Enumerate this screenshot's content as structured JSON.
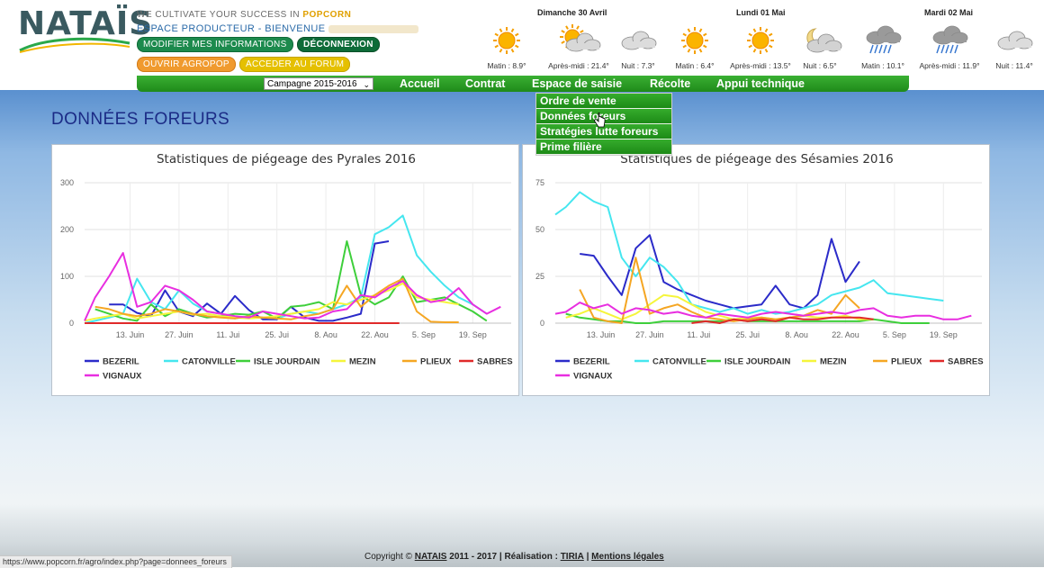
{
  "brand": {
    "logo_text": "NATAÏS",
    "tagline_prefix": "WE CULTIVATE YOUR SUCCESS IN",
    "tagline_accent": "POPCORN",
    "espace": "ESPACE PRODUCTEUR - BIENVENUE"
  },
  "header_buttons": {
    "modifier": "MODIFIER MES INFORMATIONS",
    "deconnexion": "DÉCONNEXION",
    "agropop": "OUVRIR AGROPOP",
    "forum": "ACCEDER AU FORUM"
  },
  "weather": {
    "days": [
      "Dimanche 30 Avril",
      "Lundi 01 Mai",
      "Mardi 02 Mai"
    ],
    "slots": [
      {
        "label": "Matin : 8.9°",
        "icon": "sun-icon"
      },
      {
        "label": "Après-midi : 21.4°",
        "icon": "sun-cloud-icon"
      },
      {
        "label": "Nuit : 7.3°",
        "icon": "cloud-icon"
      },
      {
        "label": "Matin : 6.4°",
        "icon": "sun-icon"
      },
      {
        "label": "Après-midi : 13.5°",
        "icon": "sun-icon"
      },
      {
        "label": "Nuit : 6.5°",
        "icon": "moon-cloud-icon"
      },
      {
        "label": "Matin : 10.1°",
        "icon": "rain-icon"
      },
      {
        "label": "Après-midi : 11.9°",
        "icon": "rain-icon"
      },
      {
        "label": "Nuit : 11.4°",
        "icon": "cloud-icon"
      }
    ]
  },
  "nav": {
    "campaign_select": "Campagne 2015-2016",
    "items": [
      "Accueil",
      "Contrat",
      "Espace de saisie",
      "Récolte",
      "Appui technique"
    ],
    "dropdown": [
      "Ordre de vente",
      "Données foreurs",
      "Stratégies lutte foreurs",
      "Prime filière"
    ]
  },
  "page_title": "DONNÉES FOREURS",
  "chart_data": [
    {
      "type": "line",
      "title": "Statistiques de piégeage des Pyrales 2016",
      "x_tick_labels": [
        "13. Juin",
        "27. Juin",
        "11. Jui",
        "25. Jui",
        "8. Aou",
        "22. Aou",
        "5. Sep",
        "19. Sep"
      ],
      "x_ticks": [
        13,
        27,
        41,
        55,
        69,
        83,
        97,
        111
      ],
      "xlim": [
        0,
        122
      ],
      "y_ticks": [
        0,
        100,
        200,
        300
      ],
      "ylim": [
        0,
        300
      ],
      "grid": true,
      "legend_placement": "bottom",
      "series": [
        {
          "name": "BEZERIL",
          "color": "#2b2bc9",
          "x": [
            7,
            11,
            15,
            19,
            23,
            27,
            31,
            35,
            39,
            43,
            47,
            51,
            55,
            59,
            63,
            67,
            71,
            75,
            79,
            83,
            87
          ],
          "y": [
            40,
            40,
            22,
            15,
            70,
            25,
            15,
            42,
            20,
            58,
            28,
            8,
            8,
            35,
            12,
            5,
            5,
            12,
            20,
            170,
            175
          ]
        },
        {
          "name": "CATONVILLE",
          "color": "#45e6ef",
          "x": [
            0,
            3,
            7,
            11,
            15,
            19,
            23,
            27,
            31,
            35,
            39,
            43,
            47,
            51,
            55,
            59,
            63,
            67,
            71,
            75,
            79,
            83,
            87,
            91,
            95,
            99,
            103,
            107,
            111,
            115
          ],
          "y": [
            0,
            5,
            12,
            20,
            95,
            45,
            30,
            70,
            42,
            25,
            20,
            10,
            15,
            12,
            10,
            20,
            25,
            20,
            30,
            40,
            55,
            190,
            205,
            230,
            145,
            110,
            80,
            55,
            40,
            20
          ]
        },
        {
          "name": "ISLE JOURDAIN",
          "color": "#3ecf3b",
          "x": [
            3,
            7,
            11,
            15,
            19,
            23,
            27,
            31,
            35,
            39,
            43,
            47,
            51,
            55,
            59,
            63,
            67,
            71,
            75,
            79,
            83,
            87,
            91,
            95,
            99,
            103,
            107,
            111,
            115
          ],
          "y": [
            30,
            20,
            10,
            5,
            40,
            15,
            30,
            20,
            12,
            15,
            20,
            18,
            25,
            10,
            35,
            38,
            45,
            30,
            175,
            60,
            40,
            55,
            100,
            45,
            50,
            55,
            40,
            25,
            5
          ]
        },
        {
          "name": "MEZIN",
          "color": "#f5f53b",
          "x": [
            0,
            3,
            7,
            11,
            15,
            19,
            23,
            27,
            31,
            35,
            39,
            43,
            47,
            51,
            55,
            59,
            63,
            67,
            71,
            75,
            79,
            83,
            87,
            91,
            95,
            99,
            103,
            107
          ],
          "y": [
            5,
            10,
            15,
            20,
            10,
            15,
            20,
            25,
            18,
            20,
            15,
            12,
            10,
            12,
            15,
            20,
            25,
            30,
            45,
            40,
            50,
            60,
            70,
            85,
            55,
            50,
            45,
            40
          ]
        },
        {
          "name": "PLIEUX",
          "color": "#f5a623",
          "x": [
            3,
            7,
            11,
            15,
            19,
            23,
            27,
            31,
            35,
            39,
            43,
            47,
            51,
            55,
            59,
            63,
            67,
            71,
            75,
            79,
            83,
            87,
            91,
            95,
            99,
            103,
            107
          ],
          "y": [
            35,
            30,
            20,
            15,
            20,
            30,
            25,
            20,
            15,
            12,
            10,
            15,
            12,
            10,
            8,
            15,
            20,
            30,
            80,
            35,
            60,
            80,
            95,
            25,
            3,
            2,
            2
          ]
        },
        {
          "name": "SABRES",
          "color": "#e02a2a",
          "x": [
            0,
            10,
            20,
            30,
            40,
            50,
            60,
            70,
            80,
            90
          ],
          "y": [
            0,
            0,
            0,
            0,
            0,
            0,
            0,
            0,
            0,
            0
          ]
        },
        {
          "name": "VIGNAUX",
          "color": "#e82ee0",
          "x": [
            0,
            3,
            7,
            11,
            15,
            19,
            23,
            27,
            31,
            35,
            39,
            43,
            47,
            51,
            55,
            59,
            63,
            67,
            71,
            75,
            79,
            83,
            87,
            91,
            95,
            99,
            103,
            107,
            111,
            115,
            119
          ],
          "y": [
            5,
            55,
            100,
            150,
            35,
            45,
            80,
            70,
            50,
            25,
            20,
            15,
            12,
            25,
            20,
            15,
            10,
            12,
            25,
            30,
            60,
            55,
            75,
            90,
            60,
            45,
            50,
            75,
            40,
            20,
            35
          ]
        }
      ]
    },
    {
      "type": "line",
      "title": "Statistiques de piégeage des Sésamies 2016",
      "x_tick_labels": [
        "13. Juin",
        "27. Juin",
        "11. Jui",
        "25. Jui",
        "8. Aou",
        "22. Aou",
        "5. Sep",
        "19. Sep"
      ],
      "x_ticks": [
        13,
        27,
        41,
        55,
        69,
        83,
        97,
        111
      ],
      "xlim": [
        0,
        122
      ],
      "y_ticks": [
        0,
        25,
        50,
        75
      ],
      "ylim": [
        0,
        75
      ],
      "grid": true,
      "legend_placement": "bottom",
      "series": [
        {
          "name": "BEZERIL",
          "color": "#2b2bc9",
          "x": [
            7,
            11,
            15,
            19,
            23,
            27,
            31,
            35,
            39,
            43,
            47,
            51,
            55,
            59,
            63,
            67,
            71,
            75,
            79,
            83,
            87
          ],
          "y": [
            37,
            36,
            25,
            15,
            40,
            47,
            22,
            18,
            15,
            12,
            10,
            8,
            9,
            10,
            20,
            10,
            8,
            15,
            45,
            22,
            33
          ]
        },
        {
          "name": "CATONVILLE",
          "color": "#45e6ef",
          "x": [
            0,
            3,
            7,
            11,
            15,
            19,
            23,
            27,
            31,
            35,
            39,
            43,
            47,
            51,
            55,
            59,
            63,
            67,
            71,
            75,
            79,
            83,
            87,
            91,
            95,
            99,
            103,
            107,
            111
          ],
          "y": [
            58,
            62,
            70,
            65,
            62,
            35,
            25,
            35,
            30,
            22,
            10,
            8,
            6,
            8,
            5,
            7,
            5,
            6,
            8,
            10,
            15,
            17,
            19,
            23,
            16,
            15,
            14,
            13,
            12
          ]
        },
        {
          "name": "ISLE JOURDAIN",
          "color": "#3ecf3b",
          "x": [
            3,
            7,
            11,
            15,
            19,
            23,
            27,
            31,
            35,
            39,
            43,
            47,
            51,
            55,
            59,
            63,
            67,
            71,
            75,
            79,
            83,
            87,
            91,
            95,
            99,
            103,
            107
          ],
          "y": [
            5,
            3,
            2,
            1,
            1,
            0,
            0,
            1,
            1,
            1,
            1,
            1,
            2,
            1,
            1,
            1,
            1,
            1,
            1,
            1,
            1,
            1,
            2,
            1,
            0,
            0,
            0
          ]
        },
        {
          "name": "MEZIN",
          "color": "#f5f53b",
          "x": [
            3,
            7,
            11,
            15,
            19,
            23,
            27,
            31,
            35,
            39,
            43,
            47,
            51,
            55,
            59,
            63,
            67,
            71,
            75,
            79,
            83,
            87,
            91
          ],
          "y": [
            3,
            5,
            8,
            5,
            2,
            5,
            10,
            15,
            14,
            10,
            6,
            4,
            2,
            3,
            3,
            2,
            3,
            4,
            3,
            3,
            4,
            2,
            2
          ]
        },
        {
          "name": "PLIEUX",
          "color": "#f5a623",
          "x": [
            7,
            11,
            15,
            19,
            23,
            27,
            31,
            35,
            39,
            43,
            47,
            51,
            55,
            59,
            63,
            67,
            71,
            75,
            79,
            83,
            87
          ],
          "y": [
            18,
            3,
            1,
            0,
            35,
            5,
            8,
            10,
            6,
            3,
            2,
            1,
            2,
            3,
            2,
            3,
            4,
            7,
            5,
            15,
            8
          ]
        },
        {
          "name": "SABRES",
          "color": "#e02a2a",
          "x": [
            39,
            43,
            47,
            51,
            55,
            59,
            63,
            67,
            71,
            75,
            79,
            83,
            87,
            91
          ],
          "y": [
            0,
            1,
            0,
            2,
            1,
            2,
            1,
            3,
            2,
            2,
            3,
            3,
            3,
            2
          ]
        },
        {
          "name": "VIGNAUX",
          "color": "#e82ee0",
          "x": [
            0,
            3,
            7,
            11,
            15,
            19,
            23,
            27,
            31,
            35,
            39,
            43,
            47,
            51,
            55,
            59,
            63,
            67,
            71,
            75,
            79,
            83,
            87,
            91,
            95,
            99,
            103,
            107,
            111,
            115,
            119
          ],
          "y": [
            5,
            6,
            11,
            8,
            10,
            5,
            8,
            7,
            5,
            6,
            4,
            3,
            5,
            4,
            3,
            5,
            6,
            5,
            4,
            5,
            6,
            5,
            7,
            8,
            4,
            3,
            4,
            4,
            2,
            2,
            4
          ]
        }
      ]
    }
  ],
  "footer": {
    "prefix": "Copyright ©",
    "brand": "NATAIS",
    "middle": "2011 - 2017 | Réalisation :",
    "tiria": "TIRIA",
    "sep": "|",
    "mentions": "Mentions légales"
  },
  "status_url": "https://www.popcorn.fr/agro/index.php?page=donnees_foreurs"
}
